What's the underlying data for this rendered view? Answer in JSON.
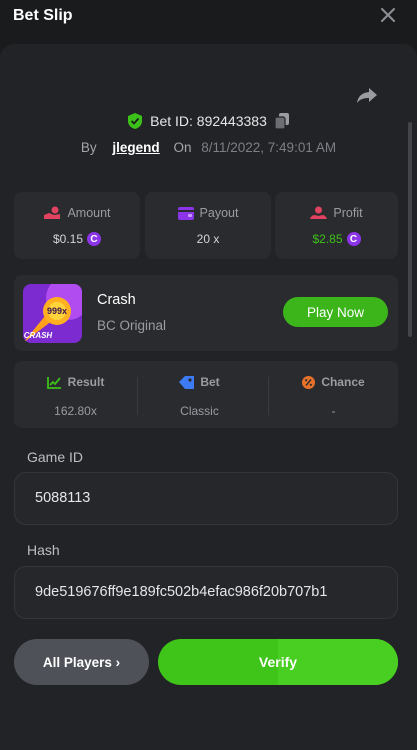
{
  "header": {
    "title": "Bet Slip"
  },
  "bet": {
    "id_label": "Bet ID: 892443383",
    "by_label": "By",
    "username": "jlegend",
    "on_label": "On",
    "date": "8/11/2022, 7:49:01 AM"
  },
  "stats": {
    "amount": {
      "label": "Amount",
      "value": "$0.15"
    },
    "payout": {
      "label": "Payout",
      "value": "20 x"
    },
    "profit": {
      "label": "Profit",
      "value": "$2.85"
    }
  },
  "game": {
    "thumb_badge": "999x",
    "thumb_title": "CRASH",
    "name": "Crash",
    "subtitle": "BC Original",
    "play_label": "Play Now"
  },
  "info": {
    "result": {
      "label": "Result",
      "value": "162.80x"
    },
    "bet": {
      "label": "Bet",
      "value": "Classic"
    },
    "chance": {
      "label": "Chance",
      "value": "-"
    }
  },
  "fields": {
    "game_id_label": "Game ID",
    "game_id_value": "5088113",
    "hash_label": "Hash",
    "hash_value": "9de519676ff9e189fc502b4efac986f20b707b1"
  },
  "actions": {
    "all_players": "All Players ›",
    "verify": "Verify"
  },
  "coin_symbol": "C",
  "colors": {
    "accent_green": "#3bb51a",
    "profit_green": "#3bc117",
    "coin_purple": "#8b34e8"
  }
}
